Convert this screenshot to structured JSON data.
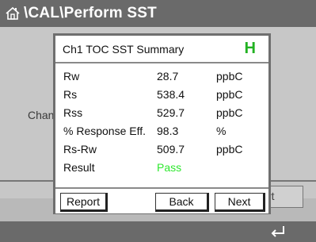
{
  "titlebar": {
    "title": "\\CAL\\Perform SST",
    "home_icon": "home-icon"
  },
  "background": {
    "label": "Chan",
    "button_label": "rt"
  },
  "dialog": {
    "title": "Ch1 TOC SST Summary",
    "status": "H",
    "status_color": "#22b222",
    "rows": [
      {
        "label": "Rw",
        "value": "28.7",
        "unit": "ppbC"
      },
      {
        "label": "Rs",
        "value": "538.4",
        "unit": "ppbC"
      },
      {
        "label": "Rss",
        "value": "529.7",
        "unit": "ppbC"
      },
      {
        "label": "% Response Eff.",
        "value": "98.3",
        "unit": "%"
      },
      {
        "label": "Rs-Rw",
        "value": "509.7",
        "unit": "ppbC"
      },
      {
        "label": "Result",
        "value": "Pass",
        "unit": ""
      }
    ],
    "result_color": "#2ee82e",
    "buttons": {
      "report": "Report",
      "back": "Back",
      "next": "Next"
    }
  },
  "bottombar": {
    "return_icon": "return-icon"
  }
}
